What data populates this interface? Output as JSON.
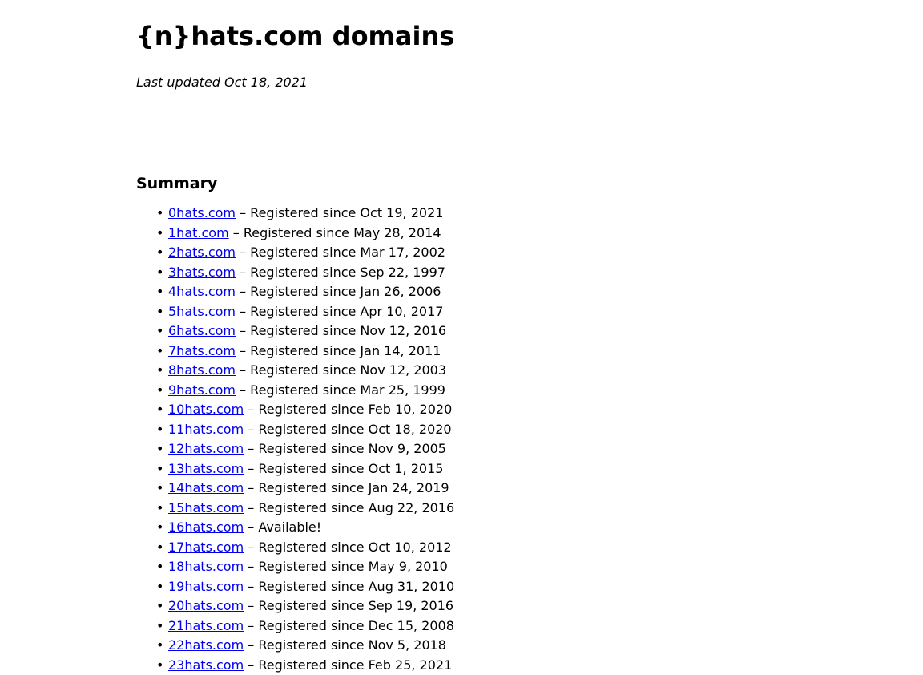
{
  "page": {
    "title": "{n}hats.com domains",
    "last_updated": "Last updated Oct 18, 2021",
    "summary_heading": "Summary",
    "bullet": "•",
    "domains": [
      {
        "name": "0hats.com",
        "status": " – Registered since Oct 19, 2021"
      },
      {
        "name": "1hat.com",
        "status": " – Registered since May 28, 2014"
      },
      {
        "name": "2hats.com",
        "status": " – Registered since Mar 17, 2002"
      },
      {
        "name": "3hats.com",
        "status": " – Registered since Sep 22, 1997"
      },
      {
        "name": "4hats.com",
        "status": " – Registered since Jan 26, 2006"
      },
      {
        "name": "5hats.com",
        "status": " – Registered since Apr 10, 2017"
      },
      {
        "name": "6hats.com",
        "status": " – Registered since Nov 12, 2016"
      },
      {
        "name": "7hats.com",
        "status": " – Registered since Jan 14, 2011"
      },
      {
        "name": "8hats.com",
        "status": " – Registered since Nov 12, 2003"
      },
      {
        "name": "9hats.com",
        "status": " – Registered since Mar 25, 1999"
      },
      {
        "name": "10hats.com",
        "status": " – Registered since Feb 10, 2020"
      },
      {
        "name": "11hats.com",
        "status": " – Registered since Oct 18, 2020"
      },
      {
        "name": "12hats.com",
        "status": " – Registered since Nov 9, 2005"
      },
      {
        "name": "13hats.com",
        "status": " – Registered since Oct 1, 2015"
      },
      {
        "name": "14hats.com",
        "status": " – Registered since Jan 24, 2019"
      },
      {
        "name": "15hats.com",
        "status": " – Registered since Aug 22, 2016"
      },
      {
        "name": "16hats.com",
        "status": " – Available!"
      },
      {
        "name": "17hats.com",
        "status": " – Registered since Oct 10, 2012"
      },
      {
        "name": "18hats.com",
        "status": " – Registered since May 9, 2010"
      },
      {
        "name": "19hats.com",
        "status": " – Registered since Aug 31, 2010"
      },
      {
        "name": "20hats.com",
        "status": " – Registered since Sep 19, 2016"
      },
      {
        "name": "21hats.com",
        "status": " – Registered since Dec 15, 2008"
      },
      {
        "name": "22hats.com",
        "status": " – Registered since Nov 5, 2018"
      },
      {
        "name": "23hats.com",
        "status": " – Registered since Feb 25, 2021"
      }
    ]
  }
}
